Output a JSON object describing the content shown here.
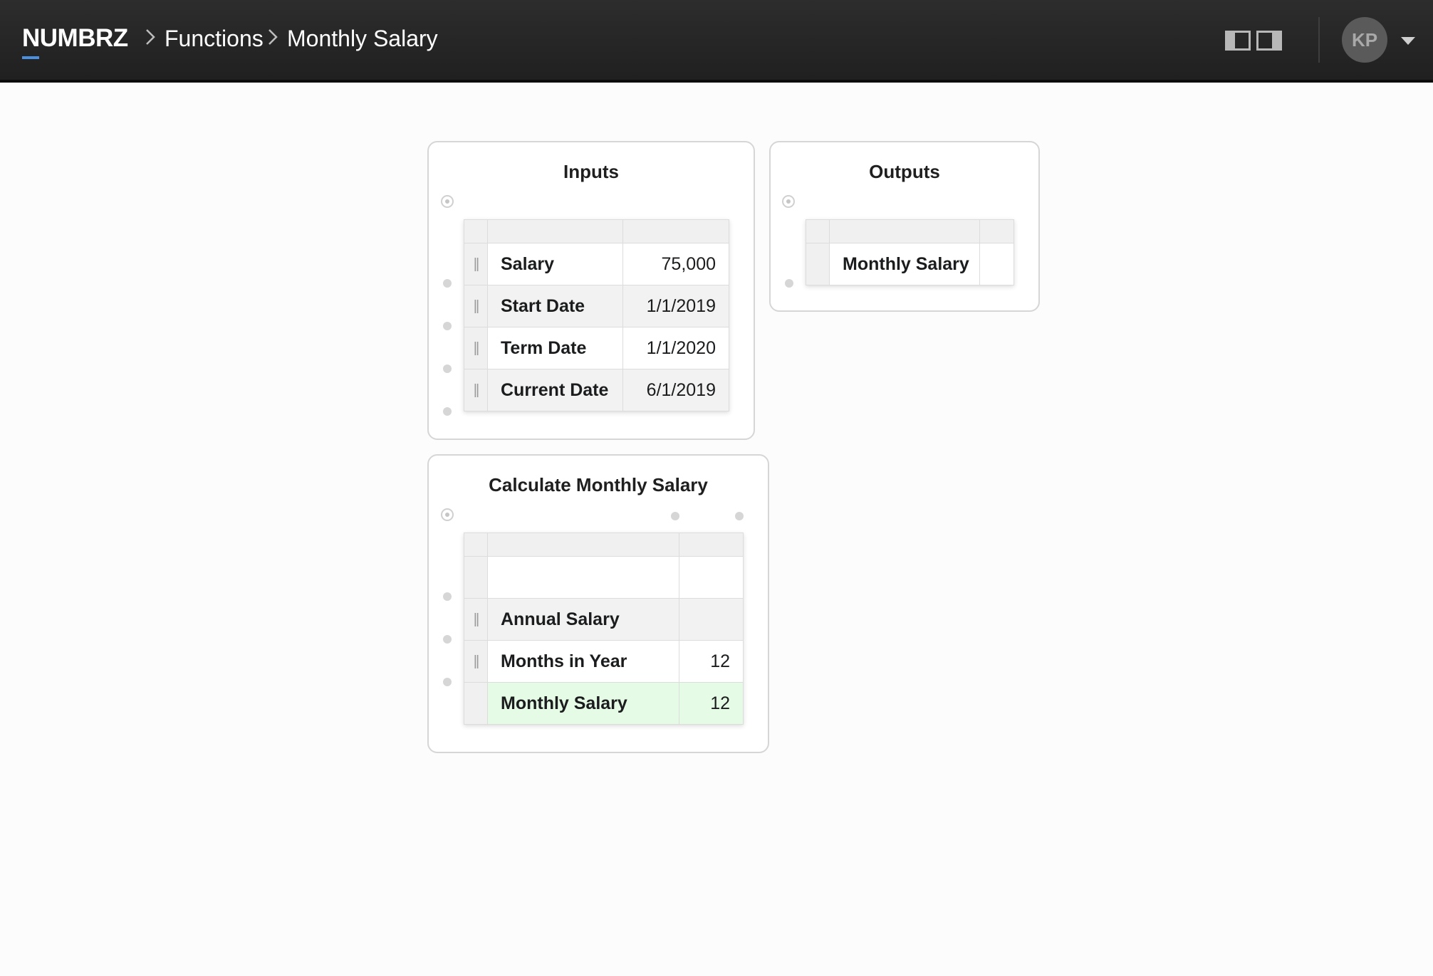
{
  "header": {
    "brand": "NUMBRZ",
    "breadcrumbs": [
      "Functions",
      "Monthly Salary"
    ],
    "avatar_initials": "KP"
  },
  "inputs": {
    "title": "Inputs",
    "rows": [
      {
        "label": "Salary",
        "value": "75,000"
      },
      {
        "label": "Start Date",
        "value": "1/1/2019"
      },
      {
        "label": "Term Date",
        "value": "1/1/2020"
      },
      {
        "label": "Current Date",
        "value": "6/1/2019"
      }
    ]
  },
  "outputs": {
    "title": "Outputs",
    "rows": [
      {
        "label": "Monthly Salary",
        "value": ""
      }
    ]
  },
  "calc": {
    "title": "Calculate Monthly Salary",
    "rows": [
      {
        "label": "",
        "value": ""
      },
      {
        "label": "Annual Salary",
        "value": ""
      },
      {
        "label": "Months in Year",
        "value": "12"
      },
      {
        "label": "Monthly Salary",
        "value": "12"
      }
    ]
  },
  "colors": {
    "header_bg": "#262626",
    "brand_accent": "#4a8fe0",
    "result_row_bg": "#e6fbe6"
  }
}
